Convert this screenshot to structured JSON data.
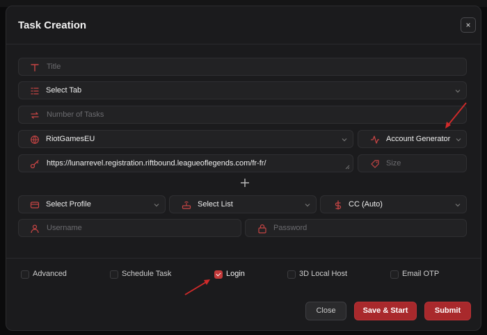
{
  "dialog": {
    "title": "Task Creation",
    "close_glyph": "×"
  },
  "form": {
    "title_placeholder": "Title",
    "tab_value": "Select Tab",
    "number_placeholder": "Number of Tasks",
    "site_value": "RiotGamesEU",
    "mode_value": "Account Generator",
    "url_value": "https://lunarrevel.registration.riftbound.leagueoflegends.com/fr-fr/",
    "size_placeholder": "Size",
    "profile_value": "Select Profile",
    "list_value": "Select List",
    "payment_value": "CC (Auto)",
    "username_placeholder": "Username",
    "password_placeholder": "Password"
  },
  "options": [
    {
      "label": "Advanced",
      "checked": false
    },
    {
      "label": "Schedule Task",
      "checked": false
    },
    {
      "label": "Login",
      "checked": true
    },
    {
      "label": "3D Local Host",
      "checked": false
    },
    {
      "label": "Email OTP",
      "checked": false
    }
  ],
  "buttons": {
    "close": "Close",
    "save_start": "Save & Start",
    "submit": "Submit"
  },
  "colors": {
    "accent": "#c43a3a",
    "panel": "#1b1b1d",
    "field": "#222224"
  },
  "icons": [
    "text-icon",
    "list-icon",
    "repeat-icon",
    "globe-icon",
    "activity-icon",
    "key-icon",
    "tag-icon",
    "plus-icon",
    "card-icon",
    "router-icon",
    "dollar-icon",
    "user-icon",
    "lock-icon"
  ]
}
